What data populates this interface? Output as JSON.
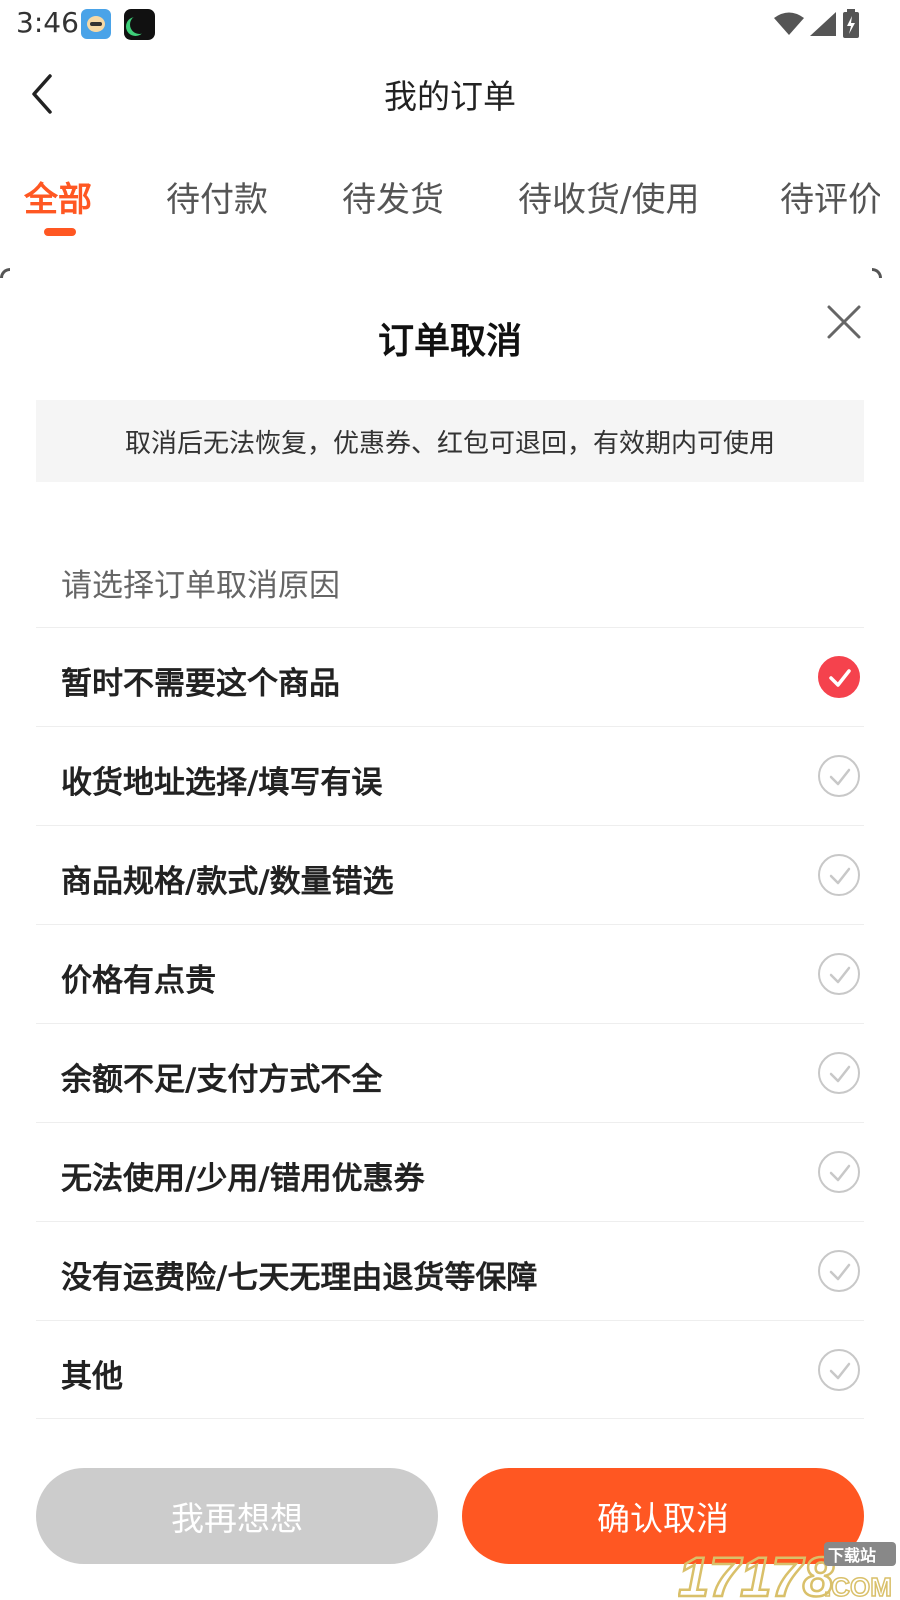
{
  "status_bar": {
    "time": "3:46",
    "icons": [
      "app-avatar-icon",
      "app-moon-icon",
      "wifi-icon",
      "cell-signal-icon",
      "battery-charging-icon"
    ]
  },
  "header": {
    "title": "我的订单",
    "back_icon": "chevron-left-icon"
  },
  "tabs": [
    {
      "label": "全部",
      "active": true
    },
    {
      "label": "待付款",
      "active": false
    },
    {
      "label": "待发货",
      "active": false
    },
    {
      "label": "待收货/使用",
      "active": false
    },
    {
      "label": "待评价",
      "active": false
    }
  ],
  "sheet": {
    "title": "订单取消",
    "close_icon": "close-icon",
    "notice": "取消后无法恢复，优惠券、红包可退回，有效期内可使用",
    "reason_header": "请选择订单取消原因",
    "reasons": [
      {
        "label": "暂时不需要这个商品",
        "selected": true
      },
      {
        "label": "收货地址选择/填写有误",
        "selected": false
      },
      {
        "label": "商品规格/款式/数量错选",
        "selected": false
      },
      {
        "label": "价格有点贵",
        "selected": false
      },
      {
        "label": "余额不足/支付方式不全",
        "selected": false
      },
      {
        "label": "无法使用/少用/错用优惠券",
        "selected": false
      },
      {
        "label": "没有运费险/七天无理由退货等保障",
        "selected": false
      },
      {
        "label": "其他",
        "selected": false
      }
    ]
  },
  "buttons": {
    "secondary_label": "我再想想",
    "primary_label": "确认取消"
  },
  "watermark": {
    "number": "17178",
    "top_text": "下载站",
    "suffix": ".COM"
  },
  "colors": {
    "accent": "#ff5722",
    "check_red": "#f5424d",
    "muted_button": "#cccccc",
    "notice_bg": "#f5f5f5"
  }
}
